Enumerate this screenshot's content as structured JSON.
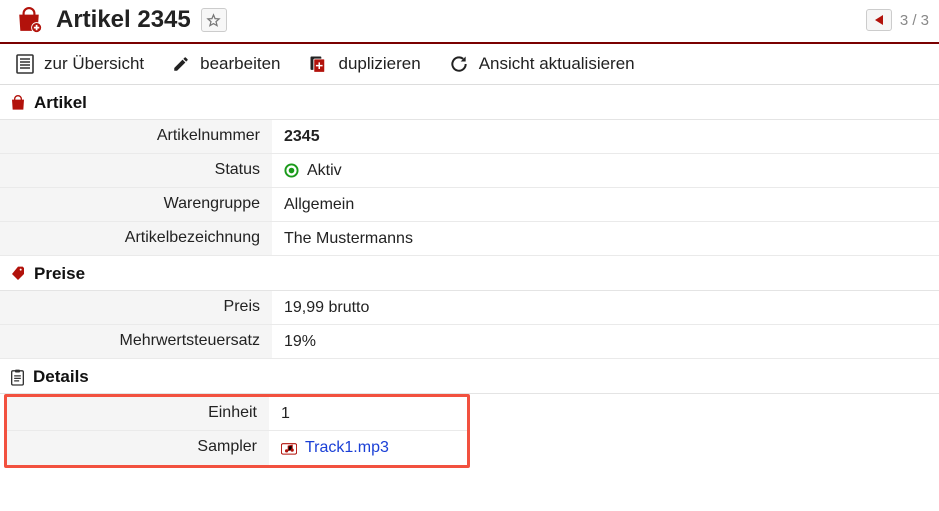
{
  "header": {
    "title": "Artikel 2345",
    "pager_text": "3 / 3"
  },
  "toolbar": {
    "overview": "zur Übersicht",
    "edit": "bearbeiten",
    "duplicate": "duplizieren",
    "refresh": "Ansicht aktualisieren"
  },
  "sections": {
    "artikel": {
      "title": "Artikel",
      "rows": {
        "nr_label": "Artikelnummer",
        "nr_value": "2345",
        "status_label": "Status",
        "status_value": "Aktiv",
        "group_label": "Warengruppe",
        "group_value": "Allgemein",
        "name_label": "Artikelbezeichnung",
        "name_value": "The Mustermanns"
      }
    },
    "preise": {
      "title": "Preise",
      "rows": {
        "price_label": "Preis",
        "price_value": "19,99 brutto",
        "vat_label": "Mehrwertsteuersatz",
        "vat_value": "19%"
      }
    },
    "details": {
      "title": "Details",
      "rows": {
        "unit_label": "Einheit",
        "unit_value": "1",
        "sampler_label": "Sampler",
        "sampler_value": "Track1.mp3"
      }
    }
  }
}
